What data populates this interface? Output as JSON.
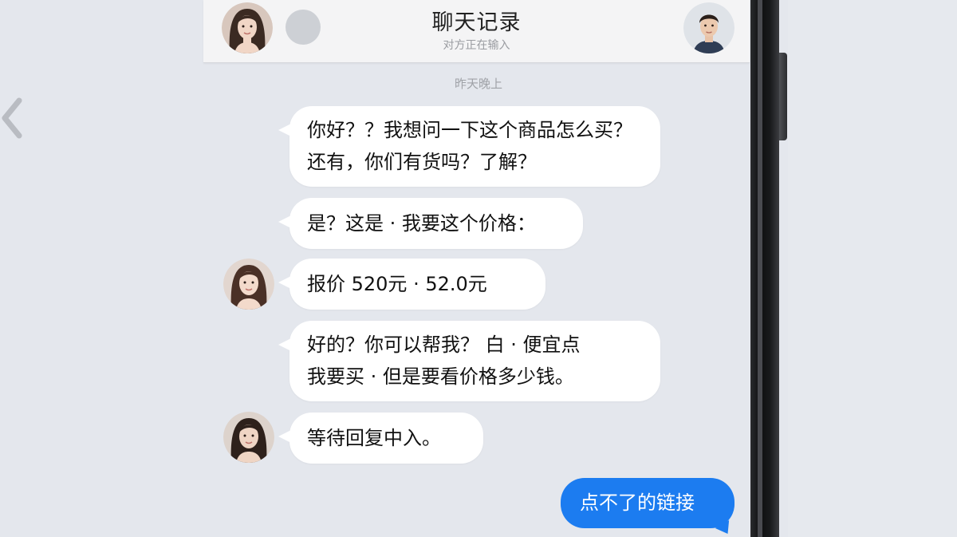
{
  "header": {
    "title": "聊天记录",
    "subtitle": "对方正在输入"
  },
  "time_label": "昨天晚上",
  "messages": [
    {
      "id": 1,
      "side": "received",
      "lines": [
        "你好？？我想问一下这个商品怎么买？",
        "还有，你们有货吗？了解？"
      ]
    },
    {
      "id": 2,
      "side": "received",
      "lines": [
        "是？这是 · 我要这个价格："
      ]
    },
    {
      "id": 3,
      "side": "received",
      "lines": [
        "报价 520元 · 52.0元"
      ]
    },
    {
      "id": 4,
      "side": "received",
      "lines": [
        "好的？你可以帮我？ 白 · 便宜点",
        "我要买 · 但是要看价格多少钱。"
      ]
    },
    {
      "id": 5,
      "side": "received",
      "lines": [
        "等待回复中入。"
      ]
    },
    {
      "id": 6,
      "side": "sent",
      "lines": [
        "点不了的链接"
      ]
    }
  ],
  "colors": {
    "background": "#e4e7ed",
    "header_bg": "#f4f4f5",
    "bubble_received": "#ffffff",
    "bubble_sent": "#1c7cf0",
    "time_label": "#9fa2a7"
  },
  "icons": {
    "back": "chevron-left-icon"
  }
}
